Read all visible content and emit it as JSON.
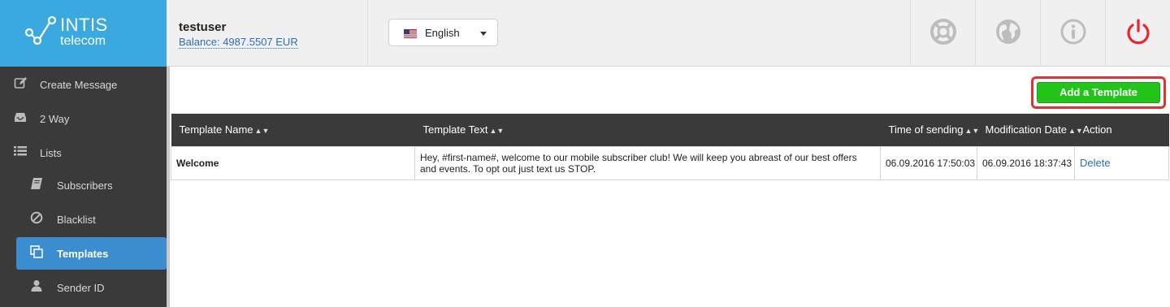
{
  "brand": {
    "line1": "INTIS",
    "line2": "telecom"
  },
  "user": {
    "name": "testuser",
    "balance": "Balance: 4987.5507 EUR"
  },
  "language": {
    "selected": "English",
    "flag": "us-flag-icon"
  },
  "header_buttons": [
    {
      "name": "support",
      "icon": "lifebuoy-icon"
    },
    {
      "name": "globe",
      "icon": "globe-icon"
    },
    {
      "name": "info",
      "icon": "info-icon"
    },
    {
      "name": "logout",
      "icon": "power-icon"
    }
  ],
  "colors": {
    "brand": "#3aa9df",
    "sidebar": "#3a3a3a",
    "active": "#3c8dcf",
    "add_button": "#22c41a",
    "highlight": "#e03434",
    "power": "#e8262c"
  },
  "sidebar": {
    "items": [
      {
        "label": "Create Message",
        "icon": "edit-icon"
      },
      {
        "label": "2 Way",
        "icon": "inbox-icon"
      },
      {
        "label": "Lists",
        "icon": "list-icon"
      },
      {
        "label": "Subscribers",
        "icon": "book-icon"
      },
      {
        "label": "Blacklist",
        "icon": "ban-icon"
      },
      {
        "label": "Templates",
        "icon": "copy-icon",
        "active": true
      },
      {
        "label": "Sender ID",
        "icon": "user-icon"
      }
    ]
  },
  "toolbar": {
    "add_label": "Add a Template"
  },
  "table": {
    "columns": [
      "Template Name",
      "Template Text",
      "Time of sending",
      "Modification Date",
      "Action"
    ],
    "sort_glyph": "▲▼",
    "rows": [
      {
        "name": "Welcome",
        "text": "Hey, #first-name#, welcome to our mobile subscriber club! We will keep you abreast of our best offers and events. To opt out just text us STOP.",
        "time_sending": "06.09.2016 17:50:03",
        "modified": "06.09.2016 18:37:43",
        "action": "Delete"
      }
    ]
  }
}
